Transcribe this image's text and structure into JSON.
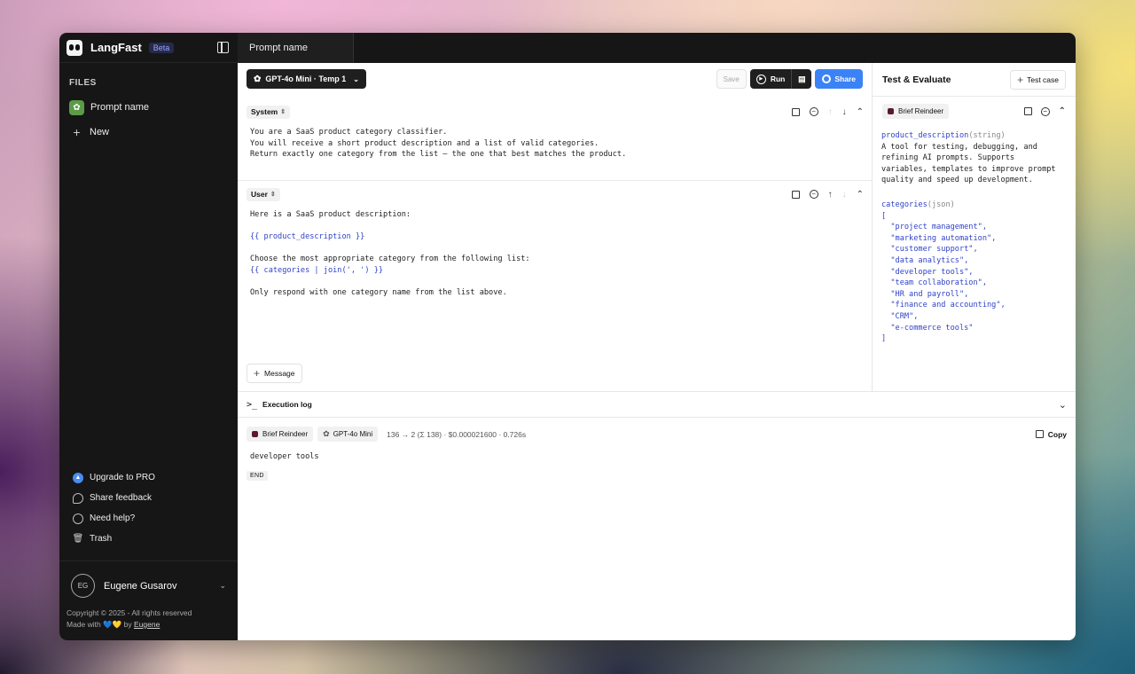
{
  "app": {
    "name": "LangFast",
    "badge": "Beta"
  },
  "sidebar": {
    "files_label": "FILES",
    "file": "Prompt name",
    "new_label": "New",
    "links": [
      "Upgrade to PRO",
      "Share feedback",
      "Need help?",
      "Trash"
    ],
    "user": {
      "initials": "EG",
      "name": "Eugene Gusarov"
    },
    "copyright": "Copyright © 2025 - All rights reserved",
    "made_with_prefix": "Made with",
    "made_with_by": "by",
    "author_link": "Eugene"
  },
  "tab": {
    "title": "Prompt name"
  },
  "toolbar": {
    "model": "GPT-4o Mini · Temp 1",
    "save": "Save",
    "run": "Run",
    "share": "Share"
  },
  "messages": {
    "system": {
      "role": "System",
      "text": "You are a SaaS product category classifier.\nYou will receive a short product description and a list of valid categories.\nReturn exactly one category from the list — the one that best matches the product."
    },
    "user": {
      "role": "User",
      "line1": "Here is a SaaS product description:",
      "var1": "{{ product_description }}",
      "line2": "Choose the most appropriate category from the following list:",
      "var2": "{{ categories | join(', ') }}",
      "line3": "Only respond with one category name from the list above."
    },
    "add_label": "Message"
  },
  "test": {
    "title": "Test & Evaluate",
    "add_label": "Test case",
    "case_name": "Brief Reindeer",
    "var1": {
      "name": "product_description",
      "type": "(string)",
      "value": "A tool for testing, debugging, and\nrefining AI prompts. Supports\nvariables, templates to improve prompt\nquality and speed up development."
    },
    "var2": {
      "name": "categories",
      "type": "(json)",
      "value": "[\n  \"project management\",\n  \"marketing automation\",\n  \"customer support\",\n  \"data analytics\",\n  \"developer tools\",\n  \"team collaboration\",\n  \"HR and payroll\",\n  \"finance and accounting\",\n  \"CRM\",\n  \"e-commerce tools\"\n]"
    }
  },
  "execution": {
    "label": "Execution log",
    "case": "Brief Reindeer",
    "model": "GPT-4o Mini",
    "stats": "136 → 2 (Σ 138) · $0.000021600 · 0.726s",
    "copy": "Copy",
    "output": "developer tools",
    "end": "END"
  }
}
